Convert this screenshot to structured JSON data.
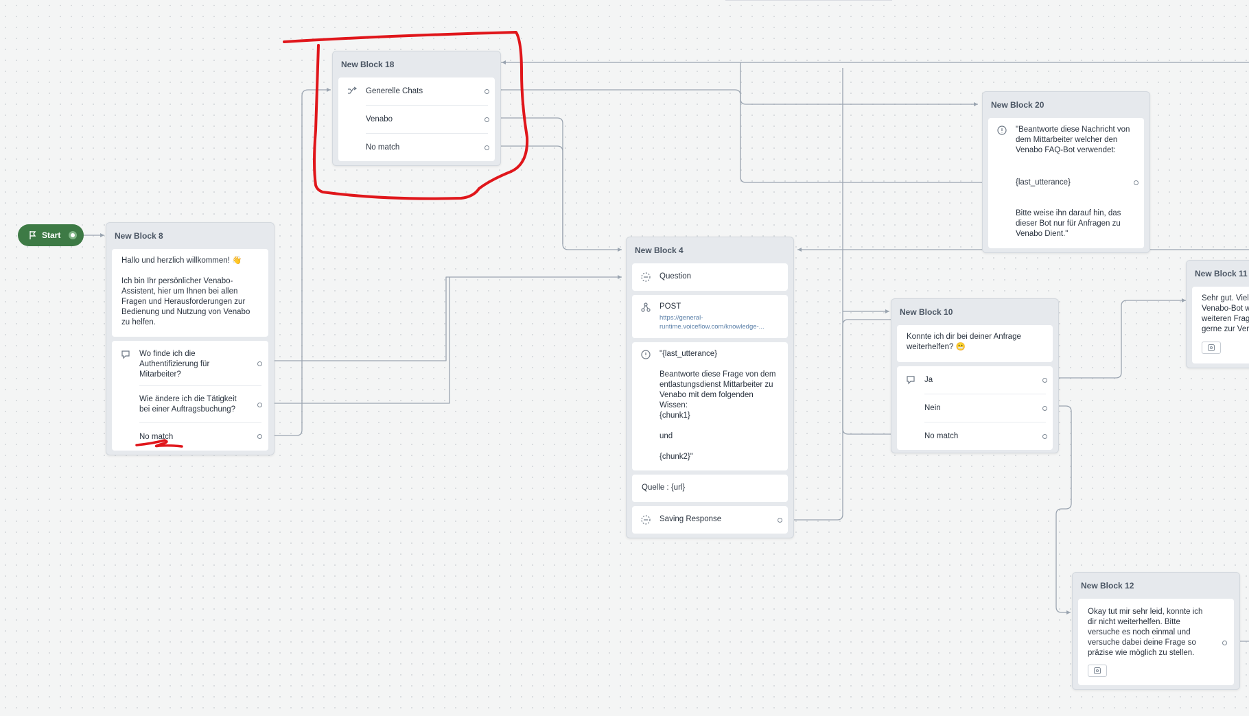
{
  "start": {
    "label": "Start"
  },
  "block18": {
    "title": "New Block 18",
    "items": [
      "Generelle Chats",
      "Venabo",
      "No match"
    ]
  },
  "block8": {
    "title": "New Block 8",
    "message": "Hallo und herzlich willkommen! 👋\n\nIch bin Ihr persönlicher Venabo-Assistent, hier um Ihnen bei allen Fragen und Herausforderungen zur Bedienung und Nutzung von Venabo zu helfen.",
    "choices": [
      "Wo finde ich die Authentifizierung für Mitarbeiter?",
      "Wie ändere ich die Tätigkeit bei einer Auftragsbuchung?",
      "No match"
    ]
  },
  "block20": {
    "title": "New Block 20",
    "text_a": "\"Beantworte diese Nachricht von dem Mittarbeiter welcher den Venabo FAQ-Bot verwendet:",
    "text_b": "{last_utterance}",
    "text_c": "Bitte weise ihn darauf hin, das dieser Bot nur für Anfragen zu Venabo Dient.\""
  },
  "block4": {
    "title": "New Block 4",
    "question_label": "Question",
    "api_method": "POST",
    "api_url": "https://general-runtime.voiceflow.com/knowledge-...",
    "prompt_a": "\"{last_utterance}",
    "prompt_b": "Beantworte diese Frage von dem entlastungsdienst Mittarbeiter zu Venabo mit dem folgenden Wissen:\n{chunk1}\n\nund\n\n{chunk2}\"",
    "source": "Quelle : {url}",
    "saving": "Saving Response"
  },
  "block10": {
    "title": "New Block 10",
    "message": "Konnte ich dir bei deiner Anfrage weiterhelfen? 😬",
    "choices": [
      "Ja",
      "Nein",
      "No match"
    ]
  },
  "block11": {
    "title": "New Block 11",
    "message": "Sehr gut. Viel\nVenabo-Bot w\nweiteren Frag\ngerne zur Ver"
  },
  "block12": {
    "title": "New Block 12",
    "message": "Okay tut mir sehr leid, konnte ich dir nicht weiterhelfen. Bitte versuche es noch einmal und versuche dabei deine Frage so präzise wie möglich zu stellen."
  },
  "colors": {
    "start_green": "#3d7a45",
    "connector": "#9aa4b0",
    "annotation_red": "#e0161b"
  }
}
